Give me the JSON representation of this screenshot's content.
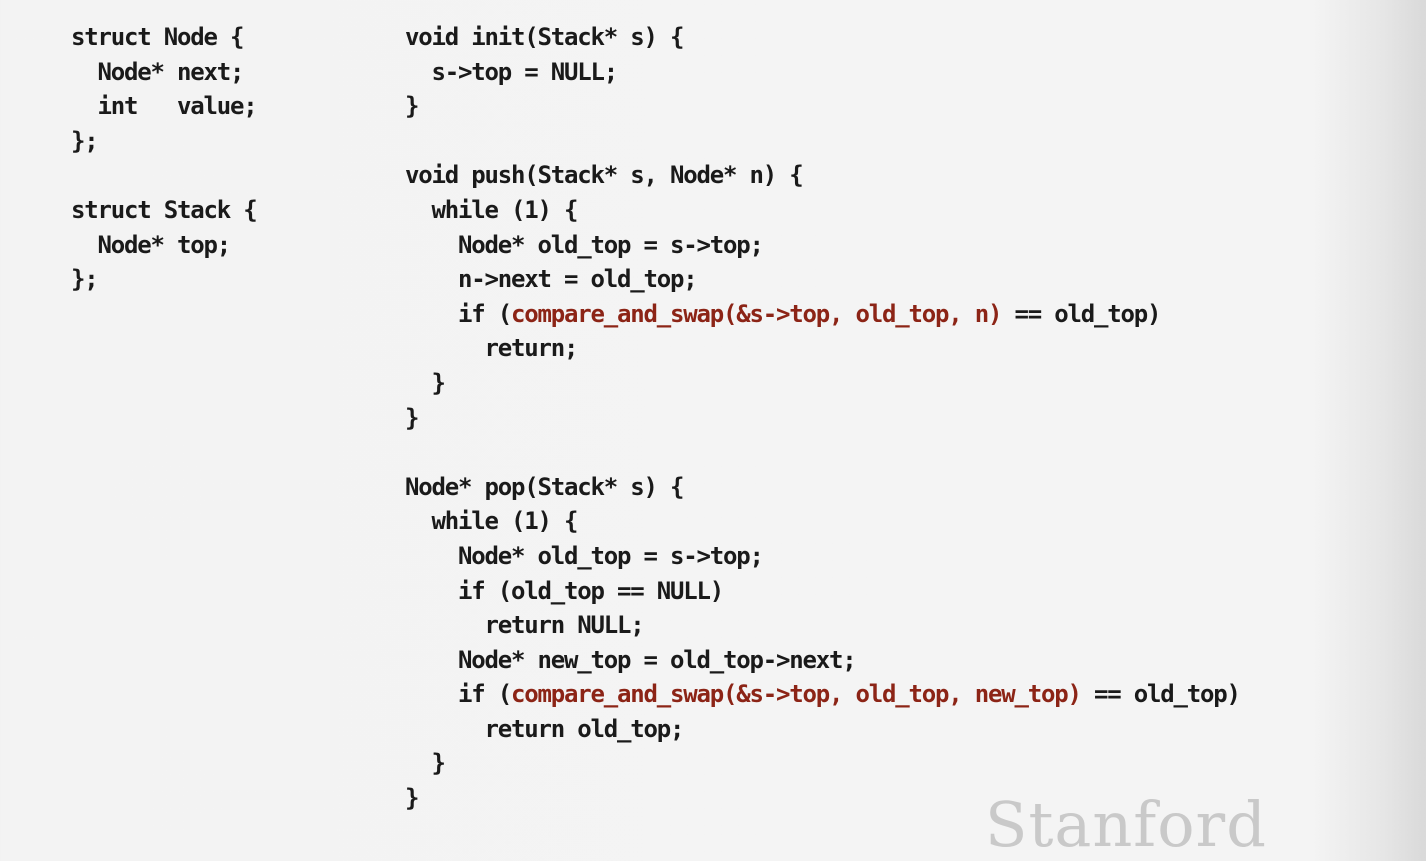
{
  "slide": {
    "left_code": [
      [
        {
          "t": "struct Node {",
          "h": false
        }
      ],
      [
        {
          "t": "  Node* next;",
          "h": false
        }
      ],
      [
        {
          "t": "  int   value;",
          "h": false
        }
      ],
      [
        {
          "t": "};",
          "h": false
        }
      ],
      [
        {
          "t": "",
          "h": false
        }
      ],
      [
        {
          "t": "struct Stack {",
          "h": false
        }
      ],
      [
        {
          "t": "  Node* top;",
          "h": false
        }
      ],
      [
        {
          "t": "};",
          "h": false
        }
      ]
    ],
    "right_code": [
      [
        {
          "t": "void init(Stack* s) {",
          "h": false
        }
      ],
      [
        {
          "t": "  s->top = NULL;",
          "h": false
        }
      ],
      [
        {
          "t": "}",
          "h": false
        }
      ],
      [
        {
          "t": "",
          "h": false
        }
      ],
      [
        {
          "t": "void push(Stack* s, Node* n) {",
          "h": false
        }
      ],
      [
        {
          "t": "  while (1) {",
          "h": false
        }
      ],
      [
        {
          "t": "    Node* old_top = s->top;",
          "h": false
        }
      ],
      [
        {
          "t": "    n->next = old_top;",
          "h": false
        }
      ],
      [
        {
          "t": "    if (",
          "h": false
        },
        {
          "t": "compare_and_swap(&s->top, old_top, n)",
          "h": true
        },
        {
          "t": " == old_top)",
          "h": false
        }
      ],
      [
        {
          "t": "      return;",
          "h": false
        }
      ],
      [
        {
          "t": "  }",
          "h": false
        }
      ],
      [
        {
          "t": "}",
          "h": false
        }
      ],
      [
        {
          "t": "",
          "h": false
        }
      ],
      [
        {
          "t": "Node* pop(Stack* s) {",
          "h": false
        }
      ],
      [
        {
          "t": "  while (1) {",
          "h": false
        }
      ],
      [
        {
          "t": "    Node* old_top = s->top;",
          "h": false
        }
      ],
      [
        {
          "t": "    if (old_top == NULL)",
          "h": false
        }
      ],
      [
        {
          "t": "      return NULL;",
          "h": false
        }
      ],
      [
        {
          "t": "    Node* new_top = old_top->next;",
          "h": false
        }
      ],
      [
        {
          "t": "    if (",
          "h": false
        },
        {
          "t": "compare_and_swap(&s->top, old_top, new_top)",
          "h": true
        },
        {
          "t": " == old_top)",
          "h": false
        }
      ],
      [
        {
          "t": "      return old_top;",
          "h": false
        }
      ],
      [
        {
          "t": "  }",
          "h": false
        }
      ],
      [
        {
          "t": "}",
          "h": false
        }
      ]
    ],
    "watermark_text": "Stanford",
    "colors": {
      "code_text": "#1a1a1a",
      "highlight": "#8c2416",
      "background": "#f3f3f3",
      "watermark": "#c9c9c9"
    }
  }
}
